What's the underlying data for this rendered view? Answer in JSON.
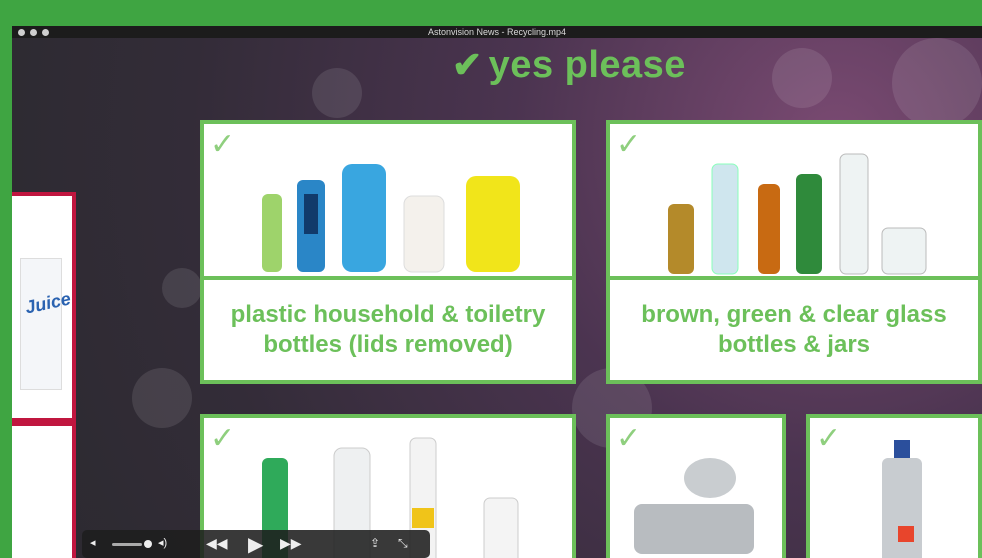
{
  "window": {
    "title": "Astonvision News - Recycling.mp4"
  },
  "video": {
    "heading": "yes please",
    "heading_check": "✔",
    "cards": [
      {
        "id": "plastic",
        "caption": "plastic household & toiletry bottles (lids removed)",
        "tick": "✓"
      },
      {
        "id": "glass",
        "caption": "brown, green & clear glass bottles & jars",
        "tick": "✓"
      },
      {
        "id": "bottles2",
        "caption": "",
        "tick": "✓"
      },
      {
        "id": "foil",
        "caption": "",
        "tick": "✓"
      },
      {
        "id": "aerosol",
        "caption": "",
        "tick": "✓"
      }
    ],
    "left_card_text": "Juice"
  },
  "player": {
    "volume_low_icon": "speaker-low-icon",
    "volume_high_icon": "speaker-high-icon",
    "rewind_icon": "rewind-icon",
    "play_icon": "play-icon",
    "forward_icon": "fast-forward-icon",
    "share_icon": "share-icon",
    "fullscreen_icon": "fullscreen-icon",
    "volume_level": 0.85
  },
  "colors": {
    "accent_green": "#6cc05a",
    "frame_green": "#3fa542",
    "red_border": "#c0163f"
  }
}
